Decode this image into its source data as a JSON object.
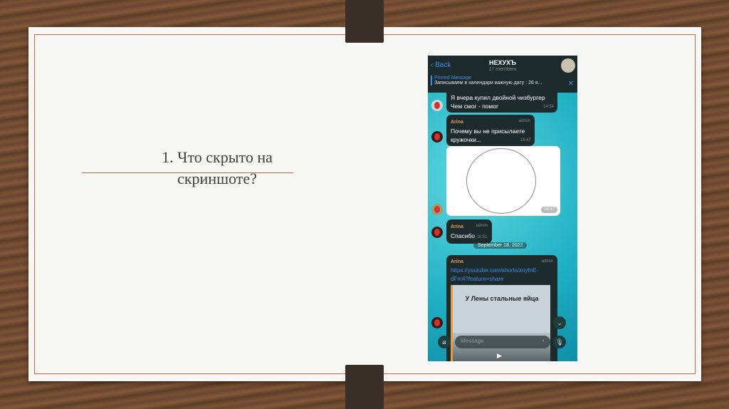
{
  "slide": {
    "title_line1": "1. Что скрыто на",
    "title_line2": "скриншоте?"
  },
  "chat": {
    "back": "‹ Back",
    "title": "НЕХУХЪ",
    "members": "17 members",
    "pinned_label": "Pinned Message",
    "pinned_text": "Записываем в календари важную дату : 26 я...",
    "messages": [
      {
        "line1": "Я вчера купил двойной чизбургер",
        "line2": "Чем смог - помог",
        "time": "14:54"
      },
      {
        "name": "Arina",
        "role": "admin",
        "line1": "Почему вы не присылаете",
        "line2": "кружочки...",
        "time": "16:47"
      },
      {
        "time": "16:47"
      },
      {
        "name": "Arina",
        "role": "admin",
        "text": "Спасибо",
        "time": "16:51"
      },
      {
        "name": "Arina",
        "role": "admin",
        "link1": "https://youtube.com/shorts/zoyfnE-",
        "link2": "dFm4?feature=share",
        "preview": "У Лены стальные яйца"
      }
    ],
    "date_separator": "September 18, 2022",
    "input_placeholder": "Message"
  }
}
